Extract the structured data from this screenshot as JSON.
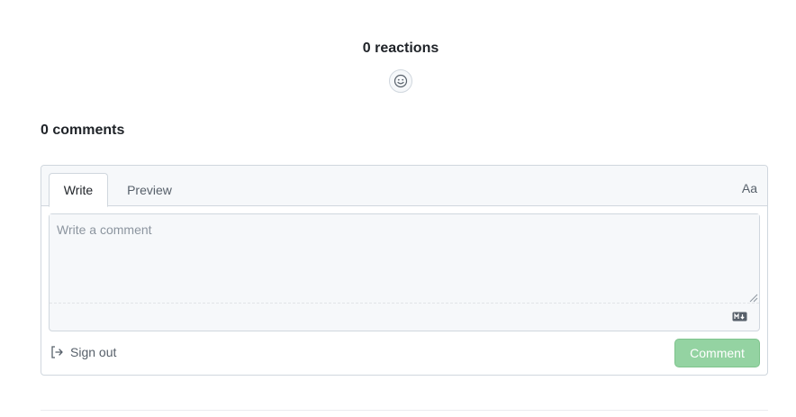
{
  "reactions": {
    "count_label": "0 reactions",
    "add_icon": "smiley-icon"
  },
  "comments": {
    "count_label": "0 comments",
    "tabs": [
      {
        "label": "Write",
        "active": true
      },
      {
        "label": "Preview",
        "active": false
      }
    ],
    "font_toggle_label": "Aa",
    "input": {
      "placeholder": "Write a comment",
      "value": ""
    },
    "markdown_icon": "markdown-icon",
    "signout": {
      "icon": "sign-out-icon",
      "label": "Sign out"
    },
    "submit_label": "Comment"
  },
  "colors": {
    "submit_bg": "#94d3a2",
    "border": "#d0d7de",
    "muted_text": "#57606a"
  }
}
